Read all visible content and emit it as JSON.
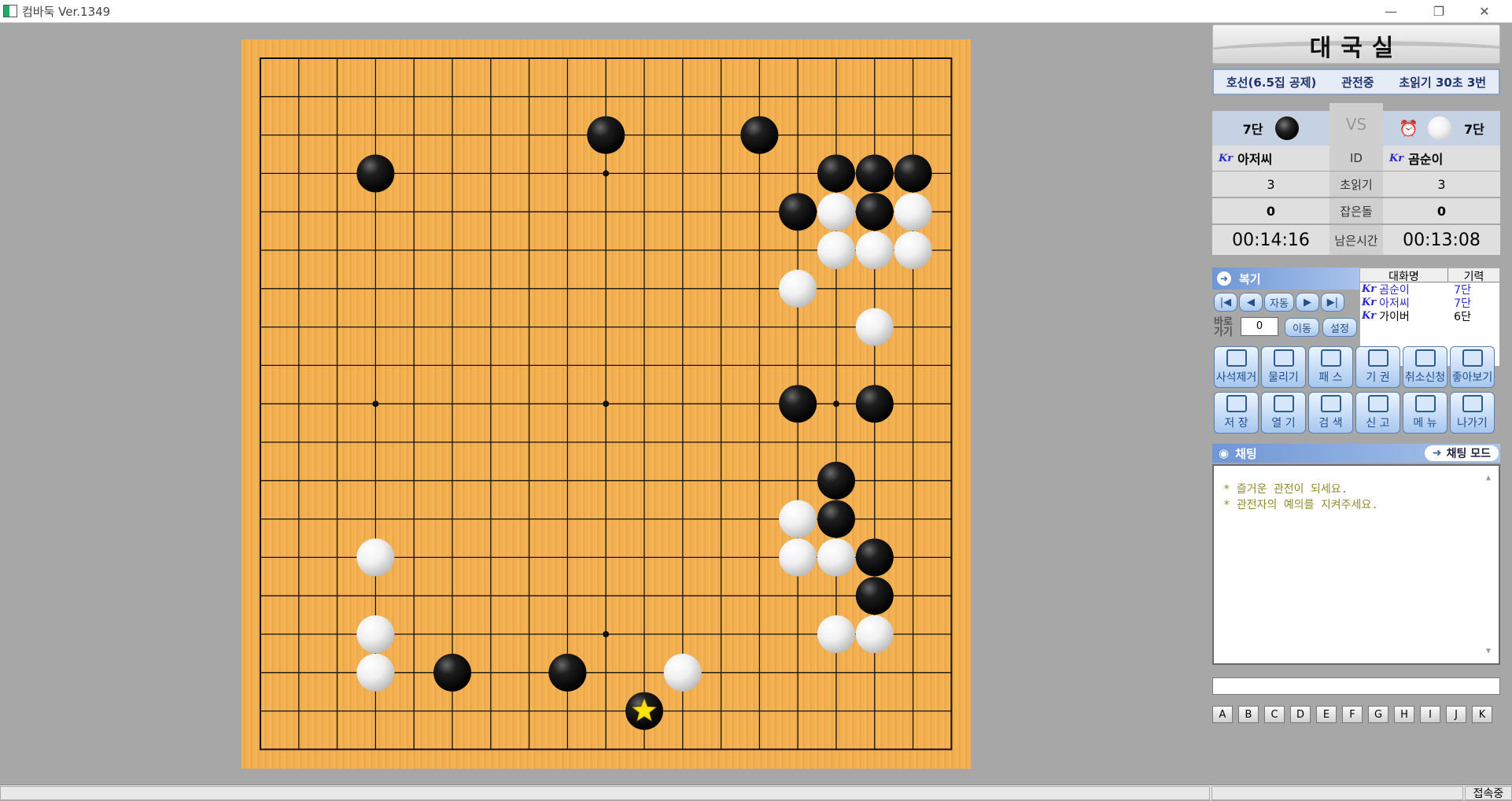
{
  "window": {
    "title": "컴바둑 Ver.1349"
  },
  "room": {
    "title": "대국실",
    "rule": "호선(6.5집 공제)",
    "status": "관전중",
    "byoyomi": "초읽기 30초 3번"
  },
  "players": {
    "vs": "VS",
    "black": {
      "rank": "7단",
      "country": "Kr",
      "name": "아저씨",
      "byoyomi": "3",
      "captured": "0",
      "time": "00:14:16"
    },
    "white": {
      "rank": "7단",
      "country": "Kr",
      "name": "곰순이",
      "byoyomi": "3",
      "captured": "0",
      "time": "00:13:08"
    },
    "labels": {
      "id": "ID",
      "byoyomi": "초읽기",
      "captured": "잡은돌",
      "time": "남은시간"
    }
  },
  "review": {
    "title": "복기",
    "auto": "자동",
    "goto_label": "바로가기",
    "goto_value": "0",
    "move": "이동",
    "settings": "설정"
  },
  "user_list": {
    "headers": [
      "대화명",
      "기력"
    ],
    "rows": [
      {
        "country": "Kr",
        "name": "곰순이",
        "rank": "7단"
      },
      {
        "country": "Kr",
        "name": "아저씨",
        "rank": "7단"
      },
      {
        "country": "Kr",
        "name": "가이버",
        "rank": "6단"
      }
    ]
  },
  "tools_row1": [
    "사석제거",
    "물리기",
    "패 스",
    "기 권",
    "취소신청",
    "좋아보기"
  ],
  "tools_row2": [
    "저 장",
    "열 기",
    "검 색",
    "신 고",
    "메 뉴",
    "나가기"
  ],
  "chat": {
    "title": "채팅",
    "mode": "채팅 모드",
    "lines": [
      "* 즐거운 관전이 되세요.",
      "* 관전자의 예의를 지켜주세요."
    ],
    "input_value": ""
  },
  "letters": [
    "A",
    "B",
    "C",
    "D",
    "E",
    "F",
    "G",
    "H",
    "I",
    "J",
    "K"
  ],
  "status": {
    "connection": "접속중"
  },
  "board": {
    "size": 19,
    "last_move": [
      10,
      17
    ],
    "black": [
      [
        9,
        2
      ],
      [
        13,
        2
      ],
      [
        3,
        3
      ],
      [
        15,
        3
      ],
      [
        16,
        3
      ],
      [
        17,
        3
      ],
      [
        14,
        4
      ],
      [
        16,
        4
      ],
      [
        14,
        9
      ],
      [
        16,
        9
      ],
      [
        15,
        11
      ],
      [
        15,
        12
      ],
      [
        16,
        13
      ],
      [
        16,
        14
      ],
      [
        5,
        16
      ],
      [
        8,
        16
      ],
      [
        10,
        17
      ]
    ],
    "white": [
      [
        15,
        4
      ],
      [
        17,
        4
      ],
      [
        15,
        5
      ],
      [
        16,
        5
      ],
      [
        17,
        5
      ],
      [
        14,
        6
      ],
      [
        16,
        7
      ],
      [
        14,
        12
      ],
      [
        14,
        13
      ],
      [
        15,
        13
      ],
      [
        3,
        13
      ],
      [
        15,
        15
      ],
      [
        16,
        15
      ],
      [
        3,
        15
      ],
      [
        3,
        16
      ],
      [
        11,
        16
      ]
    ]
  }
}
